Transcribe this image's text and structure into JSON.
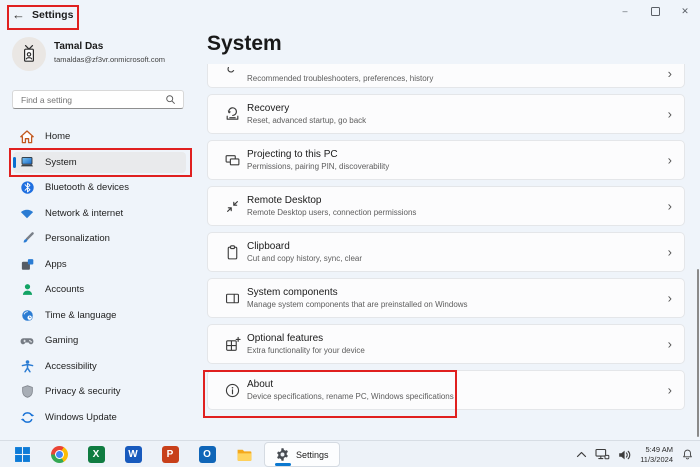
{
  "annotation": {
    "color": "#e0201f"
  },
  "titlebar": {
    "back_icon": "←",
    "title": "Settings"
  },
  "window_controls": {
    "minimize_glyph": "–",
    "close_glyph": "✕"
  },
  "profile": {
    "name": "Tamal Das",
    "email": "tamaldas@zf3vr.onmicrosoft.com"
  },
  "search": {
    "placeholder": "Find a setting"
  },
  "sidebar": {
    "items": [
      {
        "label": "Home",
        "icon": "home-icon",
        "selected": false
      },
      {
        "label": "System",
        "icon": "system-icon",
        "selected": true
      },
      {
        "label": "Bluetooth & devices",
        "icon": "bluetooth-icon",
        "selected": false
      },
      {
        "label": "Network & internet",
        "icon": "network-icon",
        "selected": false
      },
      {
        "label": "Personalization",
        "icon": "personalization-icon",
        "selected": false
      },
      {
        "label": "Apps",
        "icon": "apps-icon",
        "selected": false
      },
      {
        "label": "Accounts",
        "icon": "accounts-icon",
        "selected": false
      },
      {
        "label": "Time & language",
        "icon": "time-language-icon",
        "selected": false
      },
      {
        "label": "Gaming",
        "icon": "gaming-icon",
        "selected": false
      },
      {
        "label": "Accessibility",
        "icon": "accessibility-icon",
        "selected": false
      },
      {
        "label": "Privacy & security",
        "icon": "privacy-icon",
        "selected": false
      },
      {
        "label": "Windows Update",
        "icon": "windows-update-icon",
        "selected": false
      }
    ]
  },
  "main": {
    "title": "System",
    "chevron": "›",
    "partial_item": {
      "subtitle": "Recommended troubleshooters, preferences, history",
      "icon": "troubleshoot-icon"
    },
    "items": [
      {
        "title": "Recovery",
        "subtitle": "Reset, advanced startup, go back",
        "icon": "recovery-icon",
        "annotated": false
      },
      {
        "title": "Projecting to this PC",
        "subtitle": "Permissions, pairing PIN, discoverability",
        "icon": "projecting-icon",
        "annotated": false
      },
      {
        "title": "Remote Desktop",
        "subtitle": "Remote Desktop users, connection permissions",
        "icon": "remote-desktop-icon",
        "annotated": false
      },
      {
        "title": "Clipboard",
        "subtitle": "Cut and copy history, sync, clear",
        "icon": "clipboard-icon",
        "annotated": false
      },
      {
        "title": "System components",
        "subtitle": "Manage system components that are preinstalled on Windows",
        "icon": "system-components-icon",
        "annotated": false
      },
      {
        "title": "Optional features",
        "subtitle": "Extra functionality for your device",
        "icon": "optional-features-icon",
        "annotated": false
      },
      {
        "title": "About",
        "subtitle": "Device specifications, rename PC, Windows specifications",
        "icon": "about-icon",
        "annotated": true
      }
    ]
  },
  "taskbar": {
    "pinned_apps": [
      "start",
      "chrome",
      "excel",
      "word",
      "powerpoint",
      "outlook",
      "file-explorer"
    ],
    "app_letters": {
      "excel": "X",
      "word": "W",
      "powerpoint": "P",
      "outlook": "O"
    },
    "active_app_label": "Settings",
    "tray": {
      "time": "5:49 AM",
      "date": "11/3/2024"
    }
  }
}
